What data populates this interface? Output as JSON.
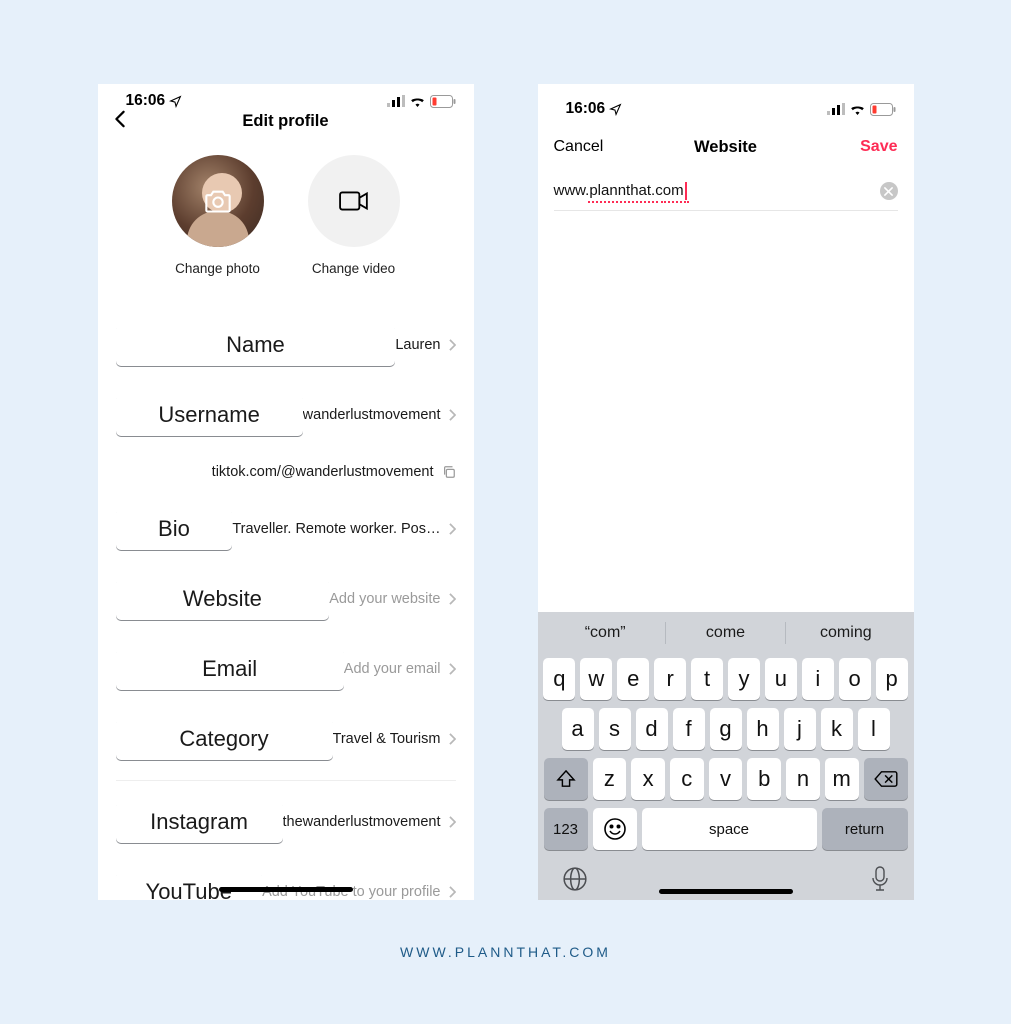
{
  "status": {
    "time": "16:06"
  },
  "left_screen": {
    "title": "Edit profile",
    "change_photo": "Change photo",
    "change_video": "Change video",
    "rows": {
      "name_label": "Name",
      "name_value": "Lauren",
      "username_label": "Username",
      "username_value": "wanderlustmovement",
      "profile_url": "tiktok.com/@wanderlustmovement",
      "bio_label": "Bio",
      "bio_value": "Traveller. Remote worker. Pos…",
      "website_label": "Website",
      "website_placeholder": "Add your website",
      "email_label": "Email",
      "email_placeholder": "Add your email",
      "category_label": "Category",
      "category_value": "Travel & Tourism",
      "instagram_label": "Instagram",
      "instagram_value": "thewanderlustmovement",
      "youtube_label": "YouTube",
      "youtube_placeholder": "Add YouTube to your profile"
    }
  },
  "right_screen": {
    "cancel": "Cancel",
    "title": "Website",
    "save": "Save",
    "url_value": "www.plannthat.com",
    "suggestions": {
      "s1": "“com”",
      "s2": "come",
      "s3": "coming"
    },
    "keys": {
      "r1": [
        "q",
        "w",
        "e",
        "r",
        "t",
        "y",
        "u",
        "i",
        "o",
        "p"
      ],
      "r2": [
        "a",
        "s",
        "d",
        "f",
        "g",
        "h",
        "j",
        "k",
        "l"
      ],
      "r3": [
        "z",
        "x",
        "c",
        "v",
        "b",
        "n",
        "m"
      ],
      "num": "123",
      "space": "space",
      "return": "return"
    }
  },
  "footer": "WWW.PLANNTHAT.COM"
}
